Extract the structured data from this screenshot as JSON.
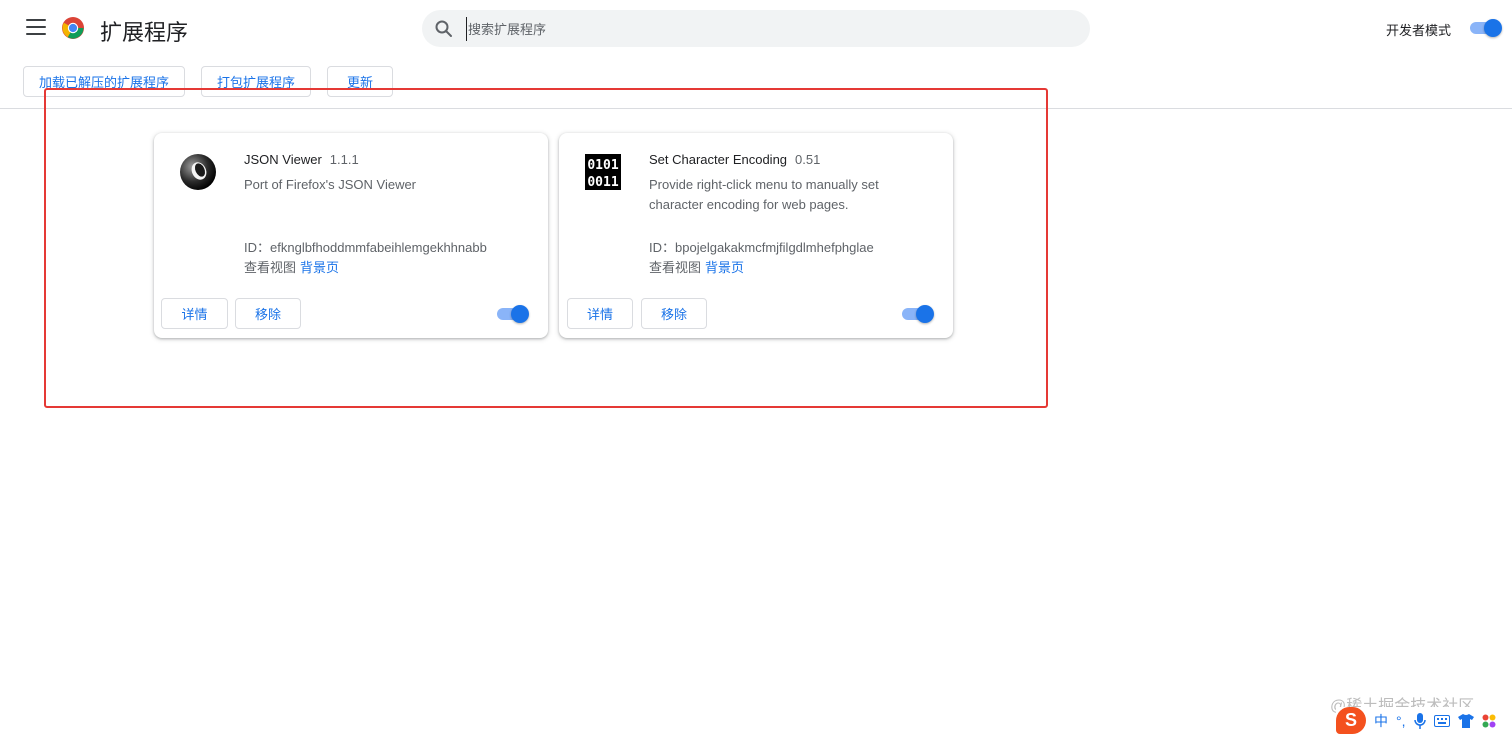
{
  "header": {
    "title": "扩展程序",
    "search_placeholder": "搜索扩展程序",
    "dev_mode_label": "开发者模式",
    "dev_mode_enabled": true
  },
  "toolbar": {
    "load_unpacked": "加载已解压的扩展程序",
    "pack_extension": "打包扩展程序",
    "update": "更新"
  },
  "extensions": [
    {
      "name": "JSON Viewer",
      "version": "1.1.1",
      "description": "Port of Firefox's JSON Viewer",
      "id_label": "ID：",
      "id": "efknglbfhoddmmfabeihlemgekhhnabb",
      "inspect_views_label": "查看视图",
      "background_page_link": "背景页",
      "details_label": "详情",
      "remove_label": "移除",
      "enabled": true,
      "icon": "json-viewer-ring-icon"
    },
    {
      "name": "Set Character Encoding",
      "version": "0.51",
      "description": "Provide right-click menu to manually set character encoding for web pages.",
      "id_label": "ID：",
      "id": "bpojelgakakmcfmjfilgdlmhefphglae",
      "inspect_views_label": "查看视图",
      "background_page_link": "背景页",
      "details_label": "详情",
      "remove_label": "移除",
      "enabled": true,
      "icon": "binary-icon",
      "icon_text_line1": "0101",
      "icon_text_line2": "0011"
    }
  ],
  "overlay": {
    "watermark": "@稀土掘金技术社区",
    "ime_logo": "S",
    "ime_mode": "中",
    "ime_punct": "°,"
  },
  "colors": {
    "accent": "#1a73e8",
    "highlight_box": "#e53935",
    "toggle_track": "#8ab4f8"
  }
}
